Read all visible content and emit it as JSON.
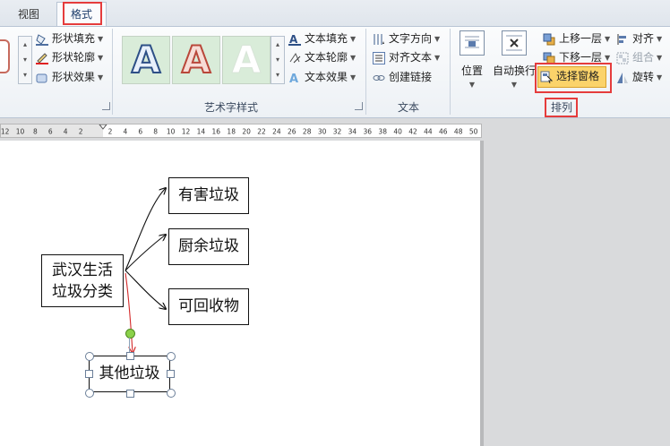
{
  "tabs": {
    "view": "视图",
    "format": "格式"
  },
  "shape_styles": {
    "fill": "形状填充",
    "outline": "形状轮廓",
    "effects": "形状效果"
  },
  "wordart": {
    "letter": "A",
    "text_fill": "文本填充",
    "text_outline": "文本轮廓",
    "text_effects": "文本效果",
    "group_label": "艺术字样式"
  },
  "text_group": {
    "direction": "文字方向",
    "align_text": "对齐文本",
    "create_link": "创建链接",
    "group_label": "文本"
  },
  "arrange": {
    "position": "位置",
    "wrap": "自动换行",
    "bring_forward": "上移一层",
    "send_backward": "下移一层",
    "selection_pane": "选择窗格",
    "align": "对齐",
    "group": "组合",
    "rotate": "旋转",
    "group_label": "排列"
  },
  "ruler": {
    "left_labels": [
      "12",
      "10",
      "8",
      "6",
      "4",
      "2"
    ],
    "right_labels": [
      "2",
      "4",
      "6",
      "8",
      "10",
      "12",
      "14",
      "16",
      "18",
      "20",
      "22",
      "24",
      "26",
      "28",
      "30",
      "32",
      "34",
      "36",
      "38",
      "40",
      "42",
      "44",
      "46",
      "48",
      "50"
    ]
  },
  "diagram": {
    "root_line1": "武汉生活",
    "root_line2": "垃圾分类",
    "child1": "有害垃圾",
    "child2": "厨余垃圾",
    "child3": "可回收物",
    "child4": "其他垃圾"
  },
  "colors": {
    "highlight": "#e53c3c",
    "selection_pane_bg": "#fbd36a"
  }
}
